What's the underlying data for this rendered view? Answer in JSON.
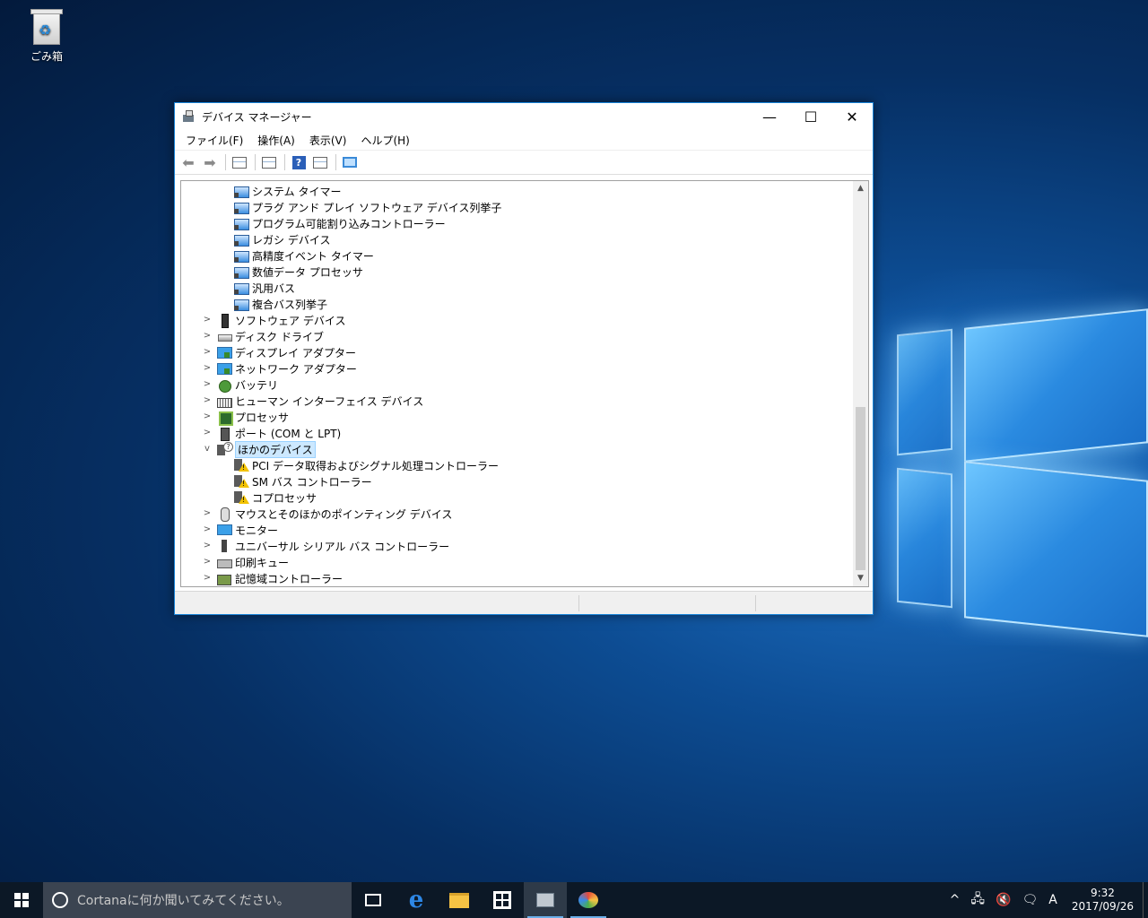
{
  "desktop": {
    "recycle_bin_label": "ごみ箱"
  },
  "window": {
    "title": "デバイス マネージャー",
    "controls": {
      "minimize": "—",
      "maximize": "☐",
      "close": "✕"
    },
    "menu": [
      "ファイル(F)",
      "操作(A)",
      "表示(V)",
      "ヘルプ(H)"
    ],
    "toolbar": {
      "back_icon": "back-arrow-icon",
      "forward_icon": "forward-arrow-icon",
      "help_glyph": "?"
    },
    "tree": [
      {
        "label": "システム タイマー",
        "level": 2,
        "icon": "device",
        "expander": ""
      },
      {
        "label": "プラグ アンド プレイ ソフトウェア デバイス列挙子",
        "level": 2,
        "icon": "device",
        "expander": ""
      },
      {
        "label": "プログラム可能割り込みコントローラー",
        "level": 2,
        "icon": "device",
        "expander": ""
      },
      {
        "label": "レガシ デバイス",
        "level": 2,
        "icon": "device",
        "expander": ""
      },
      {
        "label": "高精度イベント タイマー",
        "level": 2,
        "icon": "device",
        "expander": ""
      },
      {
        "label": "数値データ プロセッサ",
        "level": 2,
        "icon": "device",
        "expander": ""
      },
      {
        "label": "汎用バス",
        "level": 2,
        "icon": "device",
        "expander": ""
      },
      {
        "label": "複合バス列挙子",
        "level": 2,
        "icon": "device",
        "expander": ""
      },
      {
        "label": "ソフトウェア デバイス",
        "level": 1,
        "icon": "software",
        "expander": ">"
      },
      {
        "label": "ディスク ドライブ",
        "level": 1,
        "icon": "disk",
        "expander": ">"
      },
      {
        "label": "ディスプレイ アダプター",
        "level": 1,
        "icon": "display",
        "expander": ">"
      },
      {
        "label": "ネットワーク アダプター",
        "level": 1,
        "icon": "display",
        "expander": ">"
      },
      {
        "label": "バッテリ",
        "level": 1,
        "icon": "battery",
        "expander": ">"
      },
      {
        "label": "ヒューマン インターフェイス デバイス",
        "level": 1,
        "icon": "hid",
        "expander": ">"
      },
      {
        "label": "プロセッサ",
        "level": 1,
        "icon": "cpu",
        "expander": ">"
      },
      {
        "label": "ポート (COM と LPT)",
        "level": 1,
        "icon": "port",
        "expander": ">"
      },
      {
        "label": "ほかのデバイス",
        "level": 1,
        "icon": "other",
        "expander": "v",
        "selected": true
      },
      {
        "label": "PCI データ取得およびシグナル処理コントローラー",
        "level": 2,
        "icon": "warn",
        "expander": ""
      },
      {
        "label": "SM バス コントローラー",
        "level": 2,
        "icon": "warn",
        "expander": ""
      },
      {
        "label": "コプロセッサ",
        "level": 2,
        "icon": "warn",
        "expander": ""
      },
      {
        "label": "マウスとそのほかのポインティング デバイス",
        "level": 1,
        "icon": "mouse",
        "expander": ">"
      },
      {
        "label": "モニター",
        "level": 1,
        "icon": "monitor",
        "expander": ">"
      },
      {
        "label": "ユニバーサル シリアル バス コントローラー",
        "level": 1,
        "icon": "usb",
        "expander": ">"
      },
      {
        "label": "印刷キュー",
        "level": 1,
        "icon": "printer",
        "expander": ">"
      },
      {
        "label": "記憶域コントローラー",
        "level": 1,
        "icon": "storage",
        "expander": ">"
      }
    ],
    "scroll": {
      "up": "▲",
      "down": "▼"
    }
  },
  "taskbar": {
    "search_placeholder": "Cortanaに何か聞いてみてください。",
    "tray": {
      "chevron": "^",
      "ime": "A"
    },
    "clock": {
      "time": "9:32",
      "date": "2017/09/26"
    }
  }
}
